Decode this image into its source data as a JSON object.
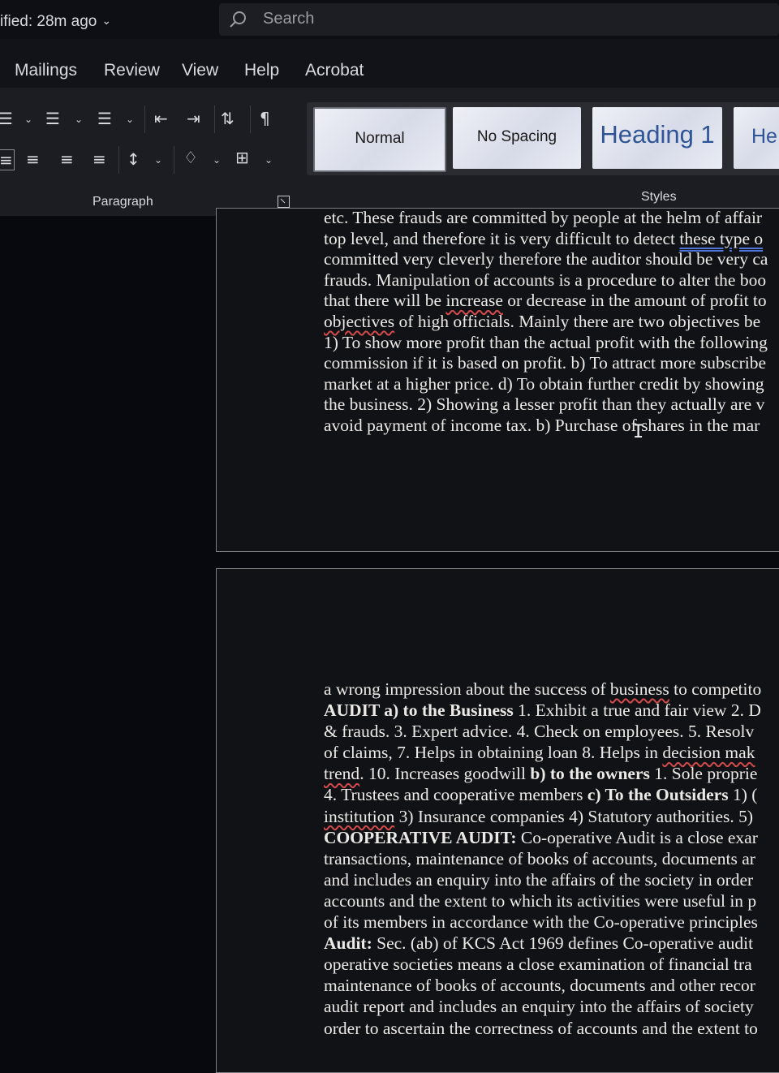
{
  "titlebar": {
    "modified_text": "ified: 28m ago",
    "search_placeholder": "Search"
  },
  "menu": {
    "tabs": [
      "Mailings",
      "Review",
      "View",
      "Help",
      "Acrobat"
    ]
  },
  "ribbon": {
    "paragraph_label": "Paragraph",
    "styles_label": "Styles",
    "styles": [
      "Normal",
      "No Spacing",
      "Heading 1",
      "He"
    ],
    "paragraph_icons": [
      "bullets-icon",
      "numbering-icon",
      "multilevel-list-icon",
      "decrease-indent-icon",
      "increase-indent-icon",
      "sort-icon",
      "show-formatting-marks-icon",
      "align-left-icon",
      "align-center-icon",
      "align-right-icon",
      "justify-icon",
      "line-spacing-icon",
      "shading-icon",
      "borders-icon"
    ]
  },
  "document": {
    "page1_lines": [
      "etc. These frauds are committed by people at the helm of affair",
      "top level, and therefore it is very difficult to detect these type o",
      "committed very cleverly therefore the auditor should be very ca",
      "frauds. Manipulation of accounts is a procedure to alter the boo",
      "that there will be increase or decrease in the amount of profit to",
      "objectives of high officials. Mainly there are two objectives be",
      "1) To show more profit than the actual profit with the following",
      "commission if it is based on profit. b) To attract more subscribe",
      "market at a higher price. d) To obtain further credit by showing",
      "the business. 2) Showing a lesser profit than they actually are v",
      "avoid payment of income tax. b) Purchase of shares in the mar"
    ],
    "page2_lines": [
      "a wrong impression about the success of business to competito",
      "AUDIT a) to the Business 1. Exhibit a true and fair view 2. D",
      "& frauds. 3. Expert advice. 4. Check on employees. 5. Resolv",
      "of claims, 7. Helps in obtaining loan 8. Helps in decision mak",
      "trend. 10. Increases goodwill b) to the owners 1. Sole proprie",
      "4. Trustees and cooperative members c) To the Outsiders 1) (",
      "institution 3) Insurance companies 4) Statutory authorities. 5)",
      "COOPERATIVE AUDIT: Co-operative Audit is a close exar",
      "transactions, maintenance of books of accounts, documents ar",
      "and includes an enquiry into the affairs of the society in order",
      "accounts and the extent to which its activities were useful in p",
      "of its members in accordance with the Co-operative principles",
      "Audit: Sec. (ab) of KCS Act 1969 defines Co-operative audit",
      "operative societies means a close examination of financial tra",
      "maintenance of books of accounts, documents and other recor",
      "audit report and includes an enquiry into the affairs of society",
      "order to ascertain the correctness of accounts and the extent to"
    ]
  }
}
